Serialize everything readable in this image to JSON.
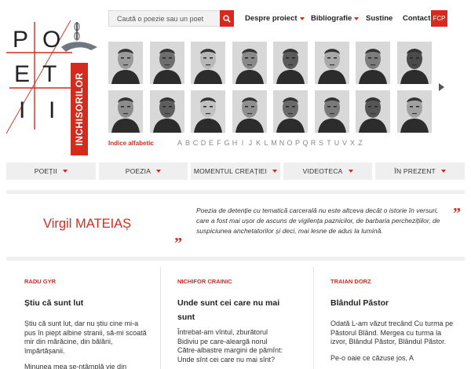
{
  "logo": {
    "letters": [
      "P",
      "O",
      "E",
      "T",
      "I",
      "I"
    ],
    "banner_text": "INCHISORILOR"
  },
  "search": {
    "placeholder": "Caută o poezie sau un poet"
  },
  "topnav": {
    "despre": "Despre proiect",
    "bibliografie": "Bibliografie",
    "sustine": "Sustine",
    "contact": "Contact",
    "fcp": "FCP"
  },
  "alphabet": {
    "button": "Indice alfabetic",
    "letters": [
      "A",
      "B",
      "C",
      "D",
      "E",
      "F",
      "G",
      "H",
      "I",
      "J",
      "K",
      "L",
      "M",
      "N",
      "O",
      "P",
      "Q",
      "R",
      "S",
      "T",
      "U",
      "V",
      "X",
      "Z"
    ]
  },
  "mainnav": [
    "POEȚII",
    "POEZIA",
    "MOMENTUL CREAȚIEI",
    "VIDEOTECA",
    "ÎN PREZENT"
  ],
  "featured": {
    "poet_name": "Virgil MATEIAȘ",
    "quote": "Poezia de detenție cu tematică carcerală nu este altceva decât o istorie în versuri, care a fost mai ușor de ascuns de vigilența paznicilor, de barbaria perchezițiilor, de suspiciunea anchetatorilor și deci, mai lesne de adus la lumină.",
    "quote_open": "”",
    "quote_close": "”"
  },
  "columns": [
    {
      "author": "RADU GYR",
      "title": "Știu că sunt lut",
      "text": "Știu că sunt lut, dar nu știu cine mi-a pus în piept albine stranii, să-mi scoată mir din mărăcine, din bălării, împărtășanii.",
      "text2": "Minunea mea se-ntâmplă vie din"
    },
    {
      "author": "NICHIFOR CRAINIC",
      "title": "Unde sunt cei care nu mai sunt",
      "text": "Întrebat-am vîntul, zburătorul\nBidiviu pe care-aleargă norul\nCătre-albastre margini de pămînt:\nUnde sînt cei care nu mai sînt?",
      "text2": ""
    },
    {
      "author": "TRAIAN DORZ",
      "title": "Blândul Păstor",
      "text": "Odată L-am văzut trecând Cu turma pe Păstorul Blând. Mergea cu turma la izvor, Blândul Păstor, Blândul Păstor.",
      "text2": "Pe-o oaie ce căzuse jos, A"
    }
  ],
  "colors": {
    "accent": "#d52b1e",
    "nav_bg": "#efefef"
  },
  "icons": {
    "search": "search-icon",
    "next": "arrow-right-icon"
  }
}
